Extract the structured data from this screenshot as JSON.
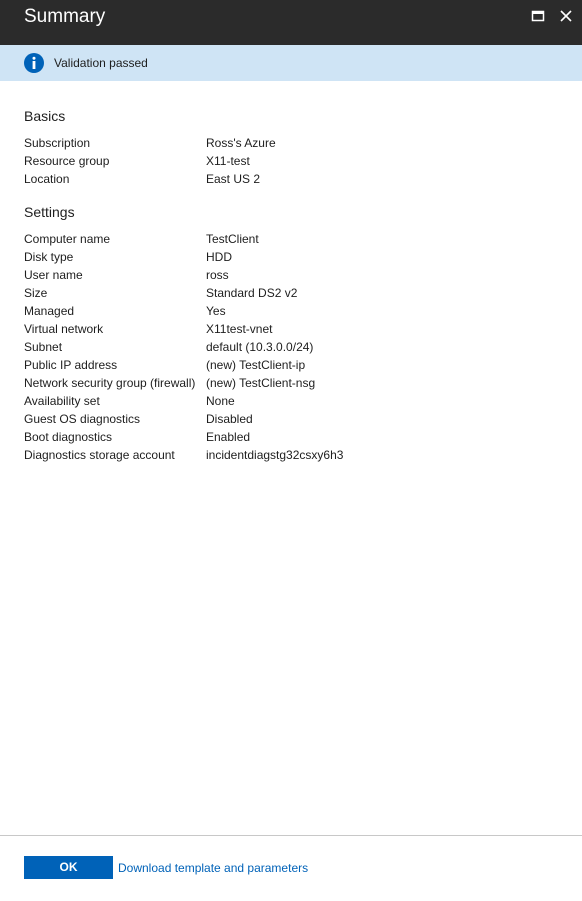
{
  "header": {
    "title": "Summary",
    "maximize_icon": "maximize-icon",
    "close_icon": "close-icon",
    "background": "#2b2b2b"
  },
  "banner": {
    "icon": "info-icon",
    "message": "Validation passed",
    "background": "#cfe4f5",
    "icon_color": "#0062b8"
  },
  "basics": {
    "title": "Basics",
    "rows": [
      {
        "label": "Subscription",
        "value": "Ross's Azure"
      },
      {
        "label": "Resource group",
        "value": "X11-test"
      },
      {
        "label": "Location",
        "value": "East US 2"
      }
    ]
  },
  "settings": {
    "title": "Settings",
    "rows": [
      {
        "label": "Computer name",
        "value": "TestClient"
      },
      {
        "label": "Disk type",
        "value": "HDD"
      },
      {
        "label": "User name",
        "value": "ross"
      },
      {
        "label": "Size",
        "value": "Standard DS2 v2"
      },
      {
        "label": "Managed",
        "value": "Yes"
      },
      {
        "label": "Virtual network",
        "value": "X11test-vnet"
      },
      {
        "label": "Subnet",
        "value": "default (10.3.0.0/24)"
      },
      {
        "label": "Public IP address",
        "value": "(new) TestClient-ip"
      },
      {
        "label": "Network security group (firewall)",
        "value": "(new) TestClient-nsg"
      },
      {
        "label": "Availability set",
        "value": "None"
      },
      {
        "label": "Guest OS diagnostics",
        "value": "Disabled"
      },
      {
        "label": "Boot diagnostics",
        "value": "Enabled"
      },
      {
        "label": "Diagnostics storage account",
        "value": "incidentdiagstg32csxy6h3"
      }
    ]
  },
  "footer": {
    "ok_label": "OK",
    "download_link": "Download template and parameters",
    "accent": "#0062b8"
  }
}
